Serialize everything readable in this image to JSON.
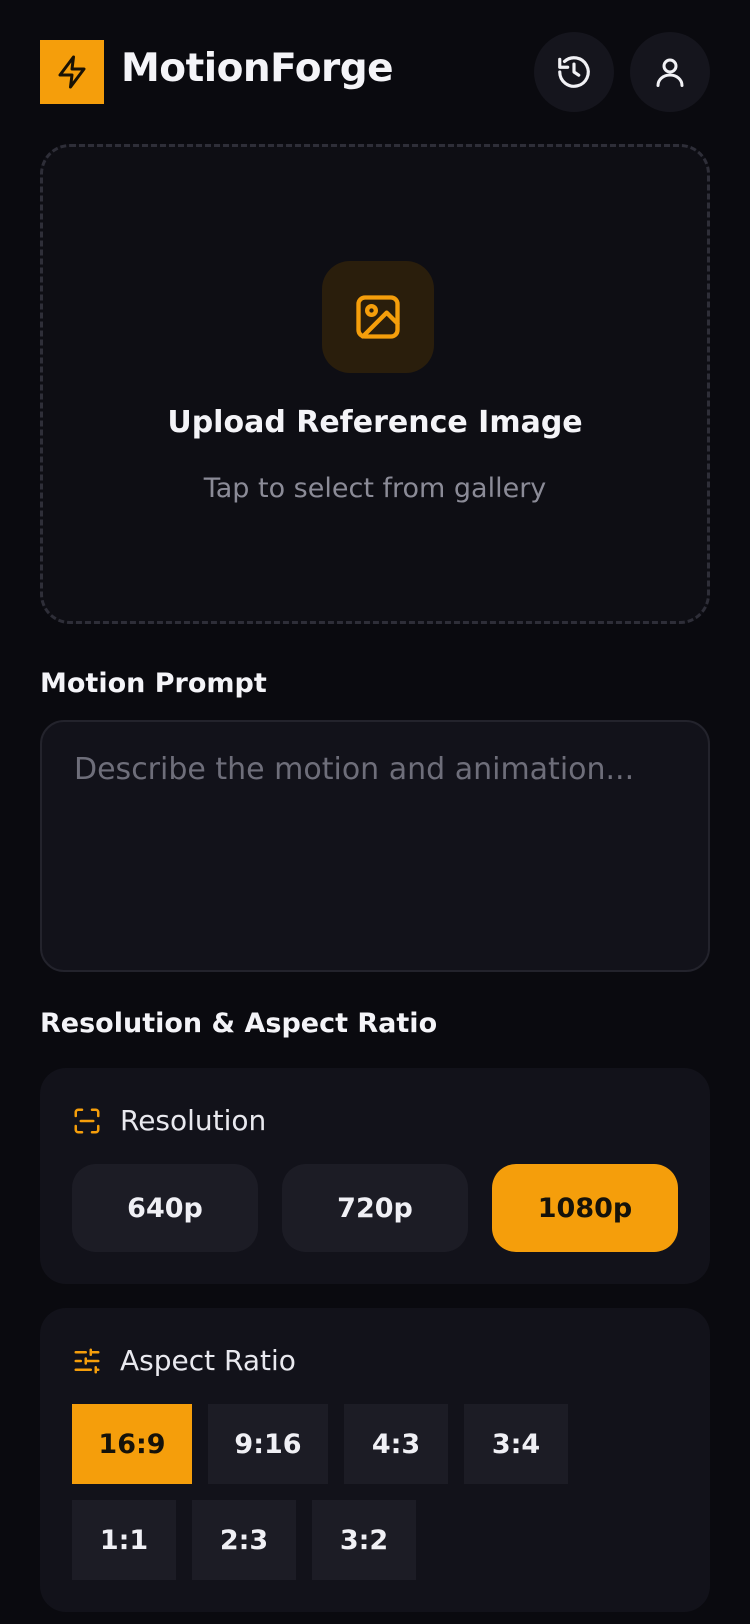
{
  "header": {
    "app_title": "MotionForge",
    "logo_icon": "lightning-bolt-icon",
    "history_icon": "history-icon",
    "profile_icon": "user-icon"
  },
  "upload": {
    "icon": "image-icon",
    "title": "Upload Reference Image",
    "subtitle": "Tap to select from gallery"
  },
  "prompt": {
    "heading": "Motion Prompt",
    "placeholder": "Describe the motion and animation...",
    "value": ""
  },
  "settings": {
    "heading": "Resolution & Aspect Ratio",
    "resolution": {
      "label": "Resolution",
      "icon": "scan-frame-icon",
      "options": [
        "640p",
        "720p",
        "1080p"
      ],
      "selected": "1080p"
    },
    "aspect_ratio": {
      "label": "Aspect Ratio",
      "icon": "sliders-icon",
      "options": [
        "16:9",
        "9:16",
        "4:3",
        "3:4",
        "1:1",
        "2:3",
        "3:2"
      ],
      "selected": "16:9"
    }
  },
  "colors": {
    "accent": "#f59e0b",
    "background": "#0a0a0f",
    "card": "#12121a",
    "button": "#1c1c25",
    "muted_text": "#8b8b97"
  }
}
